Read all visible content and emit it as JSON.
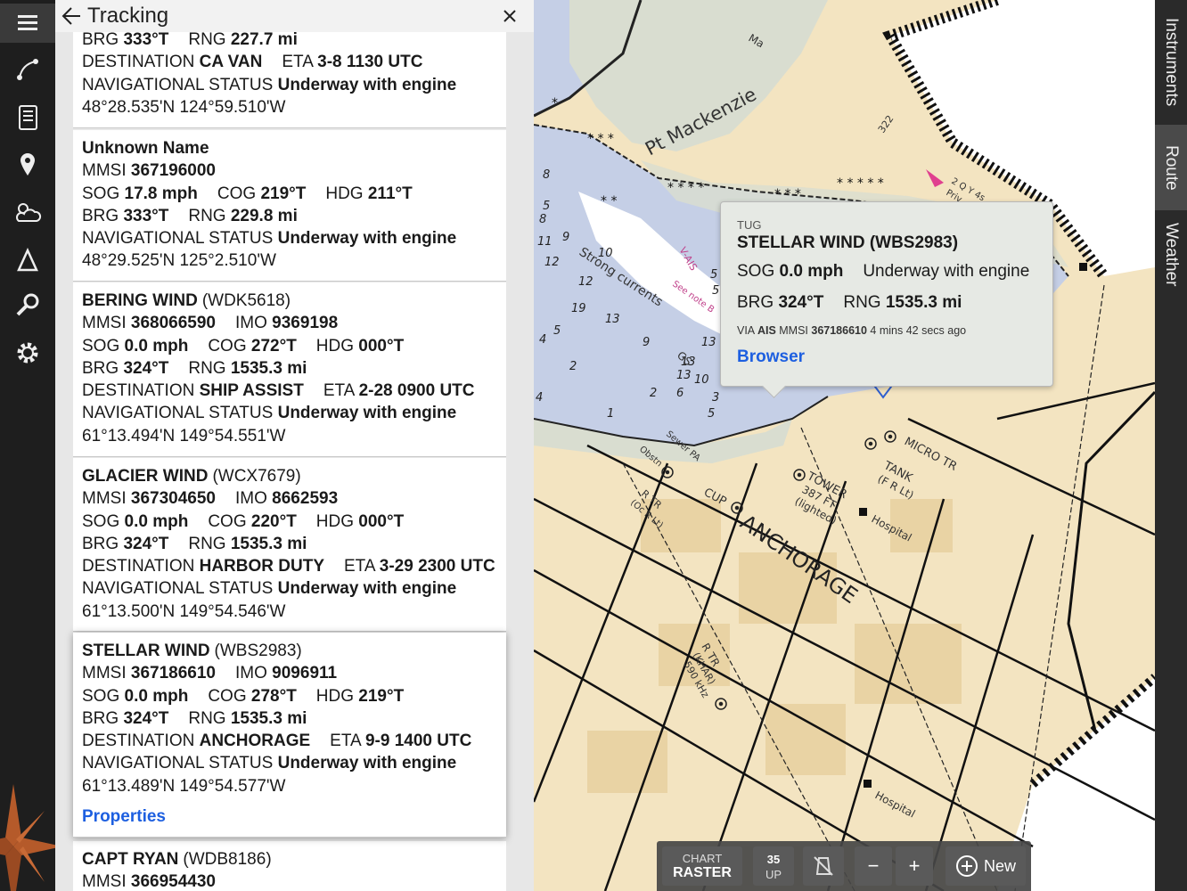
{
  "rail": {
    "icons": [
      "menu-icon",
      "route-icon",
      "logbook-icon",
      "marker-icon",
      "weather-icon",
      "triangle-icon",
      "search-icon",
      "settings-icon"
    ]
  },
  "panel": {
    "title": "Tracking"
  },
  "vessels": [
    {
      "name": "",
      "callsign": "",
      "lines": [
        [
          [
            "BRG ",
            "333°T"
          ],
          [
            "RNG ",
            "227.7 mi"
          ]
        ],
        [
          [
            "DESTINATION ",
            "CA VAN"
          ],
          [
            "ETA ",
            "3-8 1130 UTC"
          ]
        ],
        [
          [
            "NAVIGATIONAL STATUS ",
            "Underway with engine"
          ]
        ]
      ],
      "position": "48°28.535'N 124°59.510'W"
    },
    {
      "name": "Unknown Name",
      "callsign": "",
      "lines": [
        [
          [
            "MMSI ",
            "367196000"
          ]
        ],
        [
          [
            "SOG ",
            "17.8 mph"
          ],
          [
            "COG ",
            "219°T"
          ],
          [
            "HDG ",
            "211°T"
          ]
        ],
        [
          [
            "BRG ",
            "333°T"
          ],
          [
            "RNG ",
            "229.8 mi"
          ]
        ],
        [
          [
            "NAVIGATIONAL STATUS ",
            "Underway with engine"
          ]
        ]
      ],
      "position": "48°29.525'N 125°2.510'W"
    },
    {
      "name": "BERING WIND",
      "callsign": "(WDK5618)",
      "lines": [
        [
          [
            "MMSI ",
            "368066590"
          ],
          [
            "IMO ",
            "9369198"
          ]
        ],
        [
          [
            "SOG ",
            "0.0 mph"
          ],
          [
            "COG ",
            "272°T"
          ],
          [
            "HDG ",
            "000°T"
          ]
        ],
        [
          [
            "BRG ",
            "324°T"
          ],
          [
            "RNG ",
            "1535.3 mi"
          ]
        ],
        [
          [
            "DESTINATION ",
            "SHIP ASSIST"
          ],
          [
            "ETA ",
            "2-28 0900 UTC"
          ]
        ],
        [
          [
            "NAVIGATIONAL STATUS ",
            "Underway with engine"
          ]
        ]
      ],
      "position": "61°13.494'N 149°54.551'W"
    },
    {
      "name": "GLACIER WIND",
      "callsign": "(WCX7679)",
      "lines": [
        [
          [
            "MMSI ",
            "367304650"
          ],
          [
            "IMO ",
            "8662593"
          ]
        ],
        [
          [
            "SOG ",
            "0.0 mph"
          ],
          [
            "COG ",
            "220°T"
          ],
          [
            "HDG ",
            "000°T"
          ]
        ],
        [
          [
            "BRG ",
            "324°T"
          ],
          [
            "RNG ",
            "1535.3 mi"
          ]
        ],
        [
          [
            "DESTINATION ",
            "HARBOR DUTY"
          ],
          [
            "ETA ",
            "3-29 2300 UTC"
          ]
        ],
        [
          [
            "NAVIGATIONAL STATUS ",
            "Underway with engine"
          ]
        ]
      ],
      "position": "61°13.500'N 149°54.546'W"
    },
    {
      "name": "STELLAR WIND",
      "callsign": "(WBS2983)",
      "lines": [
        [
          [
            "MMSI ",
            "367186610"
          ],
          [
            "IMO ",
            "9096911"
          ]
        ],
        [
          [
            "SOG ",
            "0.0 mph"
          ],
          [
            "COG ",
            "278°T"
          ],
          [
            "HDG ",
            "219°T"
          ]
        ],
        [
          [
            "BRG ",
            "324°T"
          ],
          [
            "RNG ",
            "1535.3 mi"
          ]
        ],
        [
          [
            "DESTINATION ",
            "ANCHORAGE"
          ],
          [
            "ETA ",
            "9-9 1400 UTC"
          ]
        ],
        [
          [
            "NAVIGATIONAL STATUS ",
            "Underway with engine"
          ]
        ]
      ],
      "position": "61°13.489'N 149°54.577'W",
      "link": "Properties",
      "selected": true
    },
    {
      "name": "CAPT RYAN",
      "callsign": "(WDB8186)",
      "lines": [
        [
          [
            "MMSI ",
            "366954430"
          ]
        ]
      ],
      "position": ""
    }
  ],
  "map": {
    "labels": [
      "Pt Mackenzie",
      "Strong currents",
      "ANCHORAGE",
      "MICRO TR",
      "TANK",
      "(F R Lt)",
      "TOWER",
      "387 FT",
      "(lighted)",
      "Hospital",
      "Hospital",
      "CUP",
      "R TR",
      "(KHAR)",
      "590 kHz",
      "R TR",
      "(Oc R Lt)",
      "Sewer PA",
      "Obstn",
      "See note B",
      "V-AIS",
      "322",
      "Ma",
      "2 Q Y 4s",
      "Priv",
      "GS"
    ],
    "soundings": [
      "8",
      "9",
      "10",
      "12",
      "13",
      "19",
      "13",
      "9",
      "13",
      "6",
      "2",
      "1",
      "5",
      "4",
      "5",
      "2",
      "4",
      "8",
      "12",
      "11",
      "5",
      "3",
      "5",
      "13",
      "10",
      "5"
    ]
  },
  "popup": {
    "type": "TUG",
    "name": "STELLAR WIND (WBS2983)",
    "sog_label": "SOG ",
    "sog_value": "0.0 mph",
    "status": "Underway with engine",
    "brg_label": "BRG ",
    "brg_value": "324°T",
    "rng_label": "RNG ",
    "rng_value": "1535.3 mi",
    "via_prefix": "VIA ",
    "via_source": "AIS",
    "via_mmsi_label": " MMSI ",
    "via_mmsi": "367186610",
    "via_age": " 4 mins 42 secs ago",
    "link": "Browser"
  },
  "right_tabs": [
    {
      "label": "Instruments",
      "active": false
    },
    {
      "label": "Route",
      "active": true
    },
    {
      "label": "Weather",
      "active": false
    }
  ],
  "toolbar": {
    "chart_small": "CHART",
    "chart_big": "RASTER",
    "up_num": "35",
    "up_label": "UP",
    "zoom_out": "−",
    "zoom_in": "+",
    "new_label": "New"
  },
  "colors": {
    "land": "#f3e4c1",
    "water": "#c5cfe6",
    "tidal": "#d9ddd0",
    "link": "#1d5fe0",
    "rail": "#1e1e1e"
  }
}
